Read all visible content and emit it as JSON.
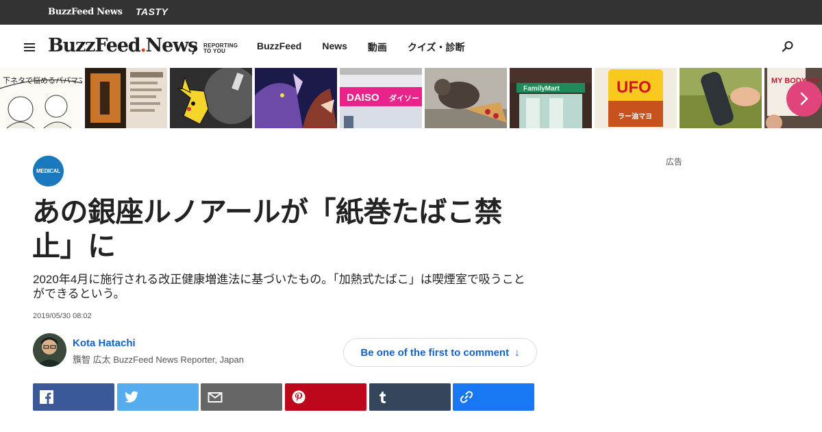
{
  "network_bar": {
    "buzzfeed_news": "BuzzFeed News",
    "tasty": "TASTY"
  },
  "header": {
    "logo_main": "BuzzFeed",
    "logo_dot": ".",
    "logo_news": "News",
    "slash": "/",
    "tagline_line1": "REPORTING",
    "tagline_line2": "TO YOU",
    "nav": [
      "BuzzFeed",
      "News",
      "動画",
      "クイズ・診断"
    ]
  },
  "trending": {
    "thumb1_text": "下ネタで悩めるパパママ教室",
    "thumb5_text": "DAISO",
    "thumb5_sub": "ダイソー",
    "thumb7_text": "FamilyMart",
    "thumb8_text": "UFO",
    "thumb8_sub": "ラー油マヨ",
    "thumb10_text": "MY BODY MY CHOICE"
  },
  "article": {
    "badge": "MEDICAL",
    "ad_label": "広告",
    "title": "あの銀座ルノアールが「紙巻たばこ禁止」に",
    "subtitle": "2020年4月に施行される改正健康増進法に基づいたもの。「加熱式たばこ」は喫煙室で吸うことができるという。",
    "timestamp": "2019/05/30 08:02",
    "author_name": "Kota Hatachi",
    "author_role": "籏智 広太 BuzzFeed News Reporter, Japan",
    "comment_label": "Be one of the first to comment",
    "comment_arrow": "↓"
  },
  "colors": {
    "facebook": "#3b5998",
    "twitter": "#55acee",
    "email": "#666666",
    "pinterest": "#bd081c",
    "tumblr": "#35465c",
    "copy_link": "#1877f2",
    "accent_pink": "#e0447a",
    "badge_blue": "#1a79bd"
  },
  "share_buttons": [
    "facebook-icon",
    "twitter-icon",
    "email-icon",
    "pinterest-icon",
    "tumblr-icon",
    "link-icon"
  ]
}
